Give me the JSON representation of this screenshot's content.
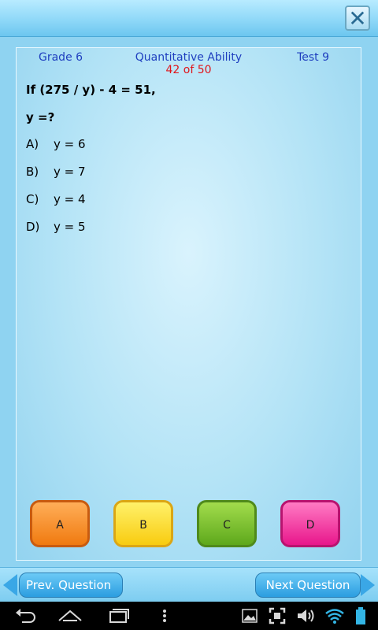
{
  "topbar": {
    "close_glyph": "✕"
  },
  "header": {
    "grade": "Grade 6",
    "subject": "Quantitative Ability",
    "test": "Test 9",
    "counter": "42 of 50"
  },
  "question": {
    "line1": "If (275 / y) - 4 = 51,",
    "line2": "y =?"
  },
  "options": [
    {
      "letter": "A)",
      "text": "y = 6"
    },
    {
      "letter": "B)",
      "text": "y = 7"
    },
    {
      "letter": "C)",
      "text": "y = 4"
    },
    {
      "letter": "D)",
      "text": "y = 5"
    }
  ],
  "answer_buttons": [
    "A",
    "B",
    "C",
    "D"
  ],
  "answer_colors": {
    "A": "#f07a10",
    "B": "#f8cc10",
    "C": "#5ea81c",
    "D": "#e8168b"
  },
  "nav": {
    "prev_label": "Prev. Question",
    "next_label": "Next Question"
  },
  "system_bar": {
    "icons": [
      "back-icon",
      "home-icon",
      "recent-apps-icon",
      "menu-dots-icon",
      "gallery-icon",
      "screenshot-icon",
      "volume-icon",
      "wifi-icon",
      "battery-icon"
    ]
  }
}
